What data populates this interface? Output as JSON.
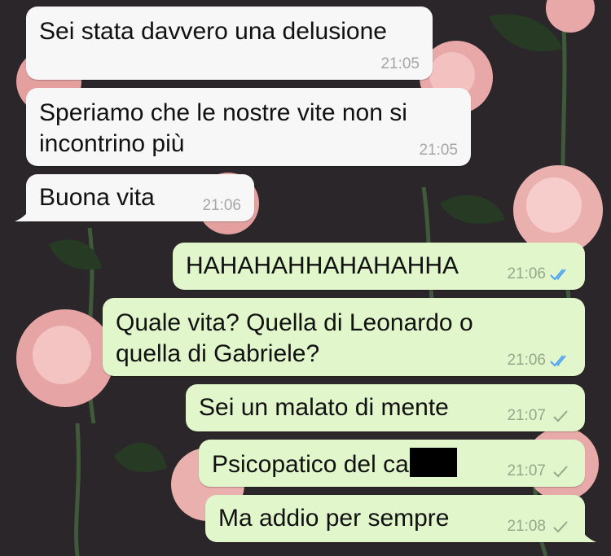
{
  "colors": {
    "incoming_bubble": "#f7f7f7",
    "outgoing_bubble": "#e1f7cb",
    "read_tick": "#4fa3f7",
    "sent_tick": "#93a88a",
    "wallpaper": "#2a2528"
  },
  "messages": [
    {
      "direction": "in",
      "text": "Sei stata davvero una delusione",
      "time": "21:05"
    },
    {
      "direction": "in",
      "text": "Speriamo che le nostre vite non si\nincontrino più",
      "time": "21:05"
    },
    {
      "direction": "in",
      "text": "Buona vita",
      "time": "21:06",
      "tail": true
    },
    {
      "direction": "out",
      "text": "HAHAHAHHAHAHAHHA",
      "time": "21:06",
      "status": "read"
    },
    {
      "direction": "out",
      "text": "Quale vita? Quella di Leonardo o\nquella di Gabriele?",
      "time": "21:06",
      "status": "read"
    },
    {
      "direction": "out",
      "text": "Sei un malato di mente",
      "time": "21:07",
      "status": "sent"
    },
    {
      "direction": "out",
      "text": "Psicopatico del ca",
      "redacted": true,
      "time": "21:07",
      "status": "sent"
    },
    {
      "direction": "out",
      "text": "Ma addio per sempre",
      "time": "21:08",
      "status": "sent",
      "tail": true
    }
  ]
}
